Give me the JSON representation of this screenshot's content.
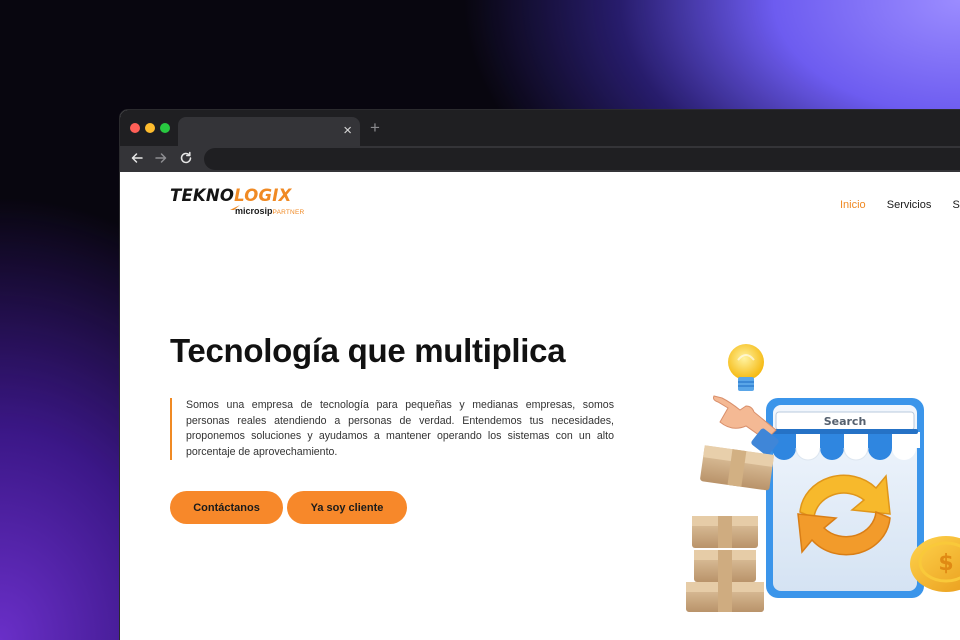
{
  "browser": {
    "tab_close_glyph": "×",
    "new_tab_glyph": "+",
    "back_icon": "arrow-left-icon",
    "forward_icon": "arrow-right-icon",
    "reload_icon": "reload-icon"
  },
  "logo": {
    "part1": "TEKNO",
    "part2": "LOGIX",
    "sub_brand": "microsip",
    "sub_tag": "PARTNER"
  },
  "nav": {
    "items": [
      {
        "label": "Inicio",
        "active": true
      },
      {
        "label": "Servicios",
        "active": false
      },
      {
        "label": "S",
        "active": false
      }
    ]
  },
  "hero": {
    "title": "Tecnología que multiplica",
    "description": "Somos una empresa de tecnología para pequeñas y medianas empresas, somos personas reales atendiendo a personas de verdad. Entendemos tus necesidades, proponemos soluciones y ayudamos a mantener operando los sistemas con un alto porcentaje de aprovechamiento.",
    "buttons": {
      "primary": "Contáctanos",
      "secondary": "Ya soy cliente"
    }
  },
  "illustration": {
    "search_label": "Search",
    "coin_symbol": "$"
  },
  "colors": {
    "accent": "#f08a24",
    "button": "#f7882a",
    "shop_blue": "#2f86e0"
  }
}
